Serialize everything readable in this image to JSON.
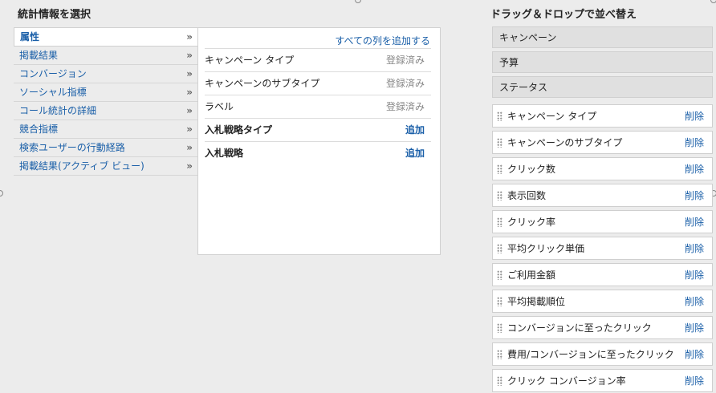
{
  "left_title": "統計情報を選択",
  "right_title": "ドラッグ＆ドロップで並べ替え",
  "chevron": "»",
  "categories": [
    "属性",
    "掲載結果",
    "コンバージョン",
    "ソーシャル指標",
    "コール統計の詳細",
    "競合指標",
    "検索ユーザーの行動経路",
    "掲載結果(アクティブ ビュー)"
  ],
  "add_all_label": "すべての列を追加する",
  "attributes": [
    {
      "name": "キャンペーン タイプ",
      "status": "登録済み"
    },
    {
      "name": "キャンペーンのサブタイプ",
      "status": "登録済み"
    },
    {
      "name": "ラベル",
      "status": "登録済み"
    },
    {
      "name": "入札戦略タイプ",
      "status": "追加"
    },
    {
      "name": "入札戦略",
      "status": "追加"
    }
  ],
  "fixed_columns": [
    "キャンペーン",
    "予算",
    "ステータス"
  ],
  "remove_label": "削除",
  "selected_columns": [
    "キャンペーン タイプ",
    "キャンペーンのサブタイプ",
    "クリック数",
    "表示回数",
    "クリック率",
    "平均クリック単価",
    "ご利用金額",
    "平均掲載順位",
    "コンバージョンに至ったクリック",
    "費用/コンバージョンに至ったクリック",
    "クリック コンバージョン率"
  ]
}
